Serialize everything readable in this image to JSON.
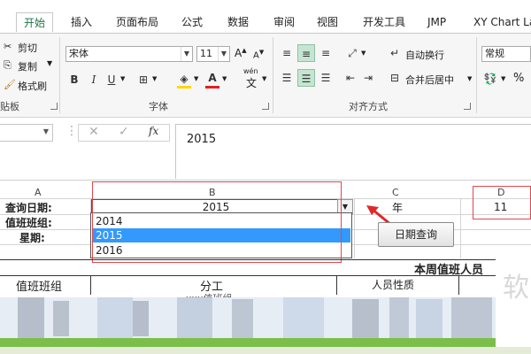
{
  "tabs": [
    {
      "label": "开始",
      "active": true
    },
    {
      "label": "插入"
    },
    {
      "label": "页面布局"
    },
    {
      "label": "公式"
    },
    {
      "label": "数据"
    },
    {
      "label": "审阅"
    },
    {
      "label": "视图"
    },
    {
      "label": "开发工具"
    },
    {
      "label": "JMP"
    },
    {
      "label": "XY Chart La"
    }
  ],
  "clipboard": {
    "cut": "剪切",
    "copy": "复制",
    "format_painter": "格式刷",
    "group": "贴板"
  },
  "font": {
    "name": "宋体",
    "size": "11",
    "group": "字体",
    "wen_label": "wén",
    "wen_char": "文"
  },
  "alignment": {
    "wrap": "自动换行",
    "merge": "合并后居中",
    "group": "对齐方式",
    "year_char": "年"
  },
  "number": {
    "format": "常规",
    "percent": "%"
  },
  "formula_bar": {
    "fx": "fx",
    "value": "2015"
  },
  "sheet": {
    "columns": {
      "a": "A",
      "b": "B",
      "c": "C",
      "d": "D"
    },
    "label_query_date": "查询日期:",
    "label_team": "值班班组:",
    "label_weekday": "星期:",
    "b1_value": "2015",
    "c1_value": "年",
    "d1_value": "11",
    "header_title": "本周值班人员",
    "header_team": "值班班组",
    "header_division": "分工",
    "header_gender": "人员性质",
    "partial_text": "xxx值班组",
    "watermark": "软"
  },
  "dropdown": {
    "options": [
      "2014",
      "2015",
      "2016"
    ],
    "selected": "2015"
  },
  "button": {
    "query": "日期查询"
  },
  "colors": {
    "accent": "#217346",
    "highlight": "#3399ff",
    "red_box": "#e0484b",
    "green_bar": "#7bbf4a"
  }
}
